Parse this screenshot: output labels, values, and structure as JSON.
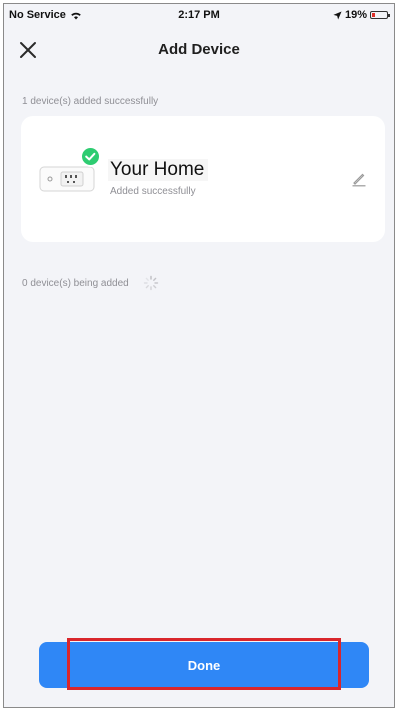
{
  "status_bar": {
    "carrier": "No Service",
    "time": "2:17 PM",
    "battery_percent": "19%",
    "battery_level": 0.19,
    "icons": [
      "wifi-icon",
      "location-arrow-icon",
      "battery-icon"
    ]
  },
  "header": {
    "title": "Add Device",
    "close_icon": "close-icon"
  },
  "success_section": {
    "label": "1 device(s) added successfully",
    "device": {
      "name": "Your Home",
      "status": "Added successfully",
      "icon": "smart-plug-icon",
      "badge_icon": "check-icon",
      "edit_icon": "pencil-icon"
    }
  },
  "adding_section": {
    "label": "0 device(s) being added",
    "icon": "loading-spinner-icon"
  },
  "footer": {
    "done_label": "Done"
  },
  "colors": {
    "background": "#f3f4f8",
    "primary": "#2f87f6",
    "success": "#2ecc71",
    "highlight": "#d9262c",
    "battery_low": "#e0312a"
  }
}
